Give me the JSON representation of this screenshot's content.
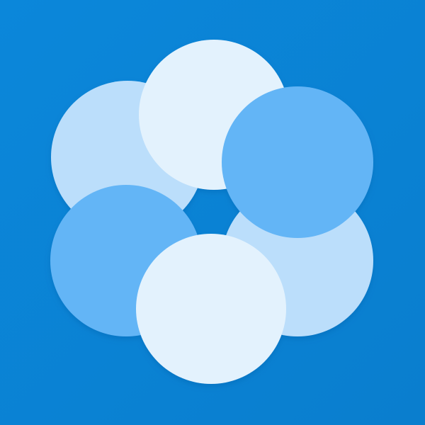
{
  "app_icon": {
    "icon_name": "overlapping-circles-flower-icon",
    "colors": {
      "background": "#0B87DA",
      "background_shade": "#0A7ECE",
      "petal_lightest": "#E3F2FD",
      "petal_light": "#BBDEFB",
      "petal_mid": "#64B5F6",
      "shadow": "#0B5FA8"
    }
  }
}
